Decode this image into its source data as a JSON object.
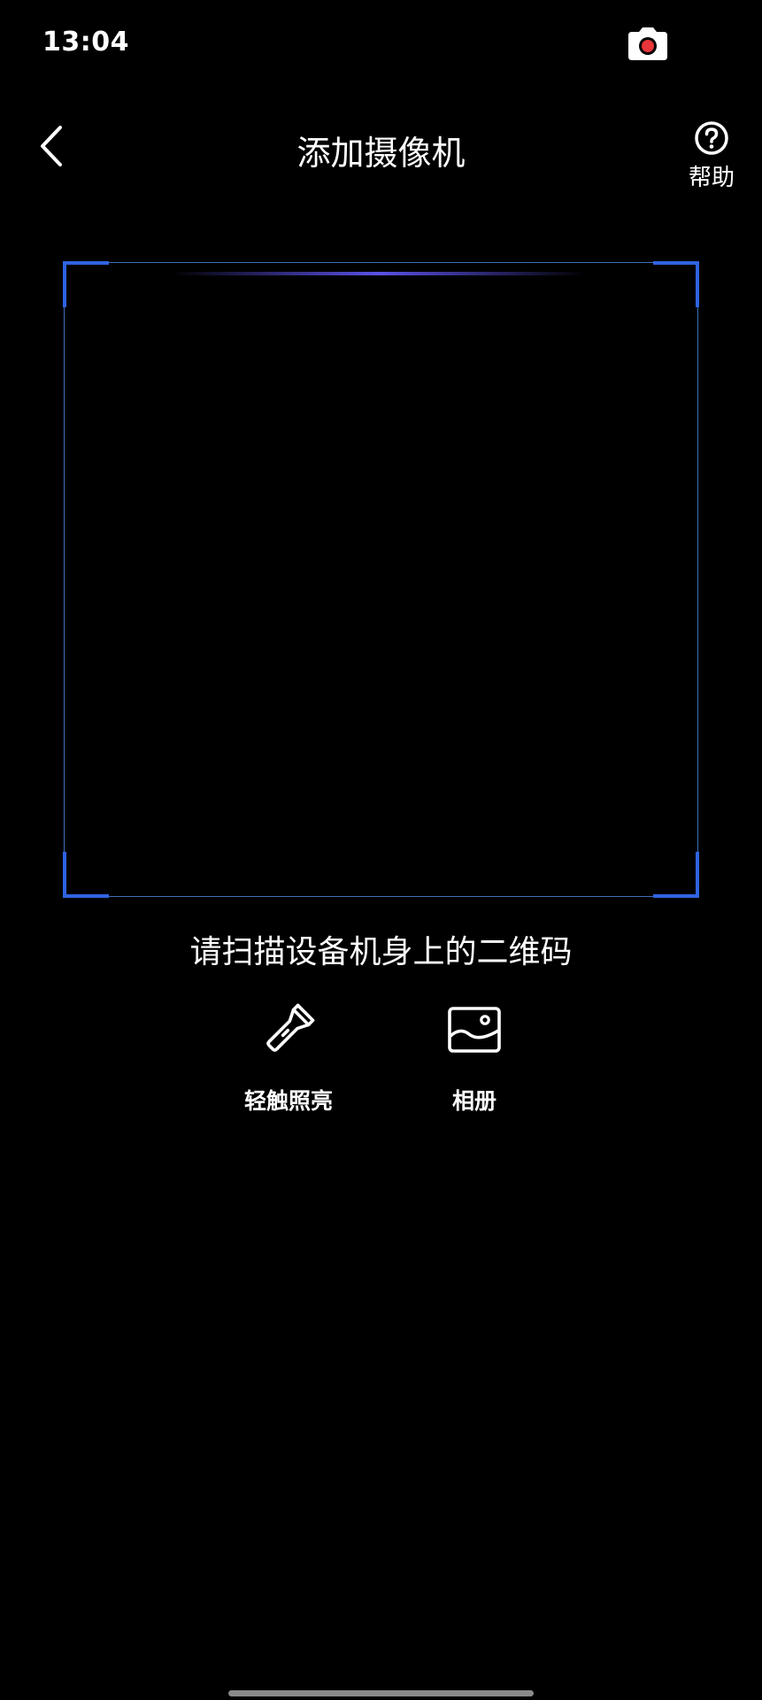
{
  "status_bar": {
    "time": "13:04",
    "indicator_icon": "camera-recording-icon",
    "indicator_dot_color": "#e8363a"
  },
  "header": {
    "back_icon": "chevron-left-icon",
    "title": "添加摄像机",
    "help_icon": "question-circle-icon",
    "help_label": "帮助"
  },
  "scanner": {
    "frame_color": "#3d6fb8",
    "corner_color": "#2f63e0",
    "scan_line_color": "#645aff",
    "hint": "请扫描设备机身上的二维码"
  },
  "actions": {
    "flashlight": {
      "icon": "flashlight-icon",
      "label": "轻触照亮"
    },
    "album": {
      "icon": "image-gallery-icon",
      "label": "相册"
    }
  }
}
